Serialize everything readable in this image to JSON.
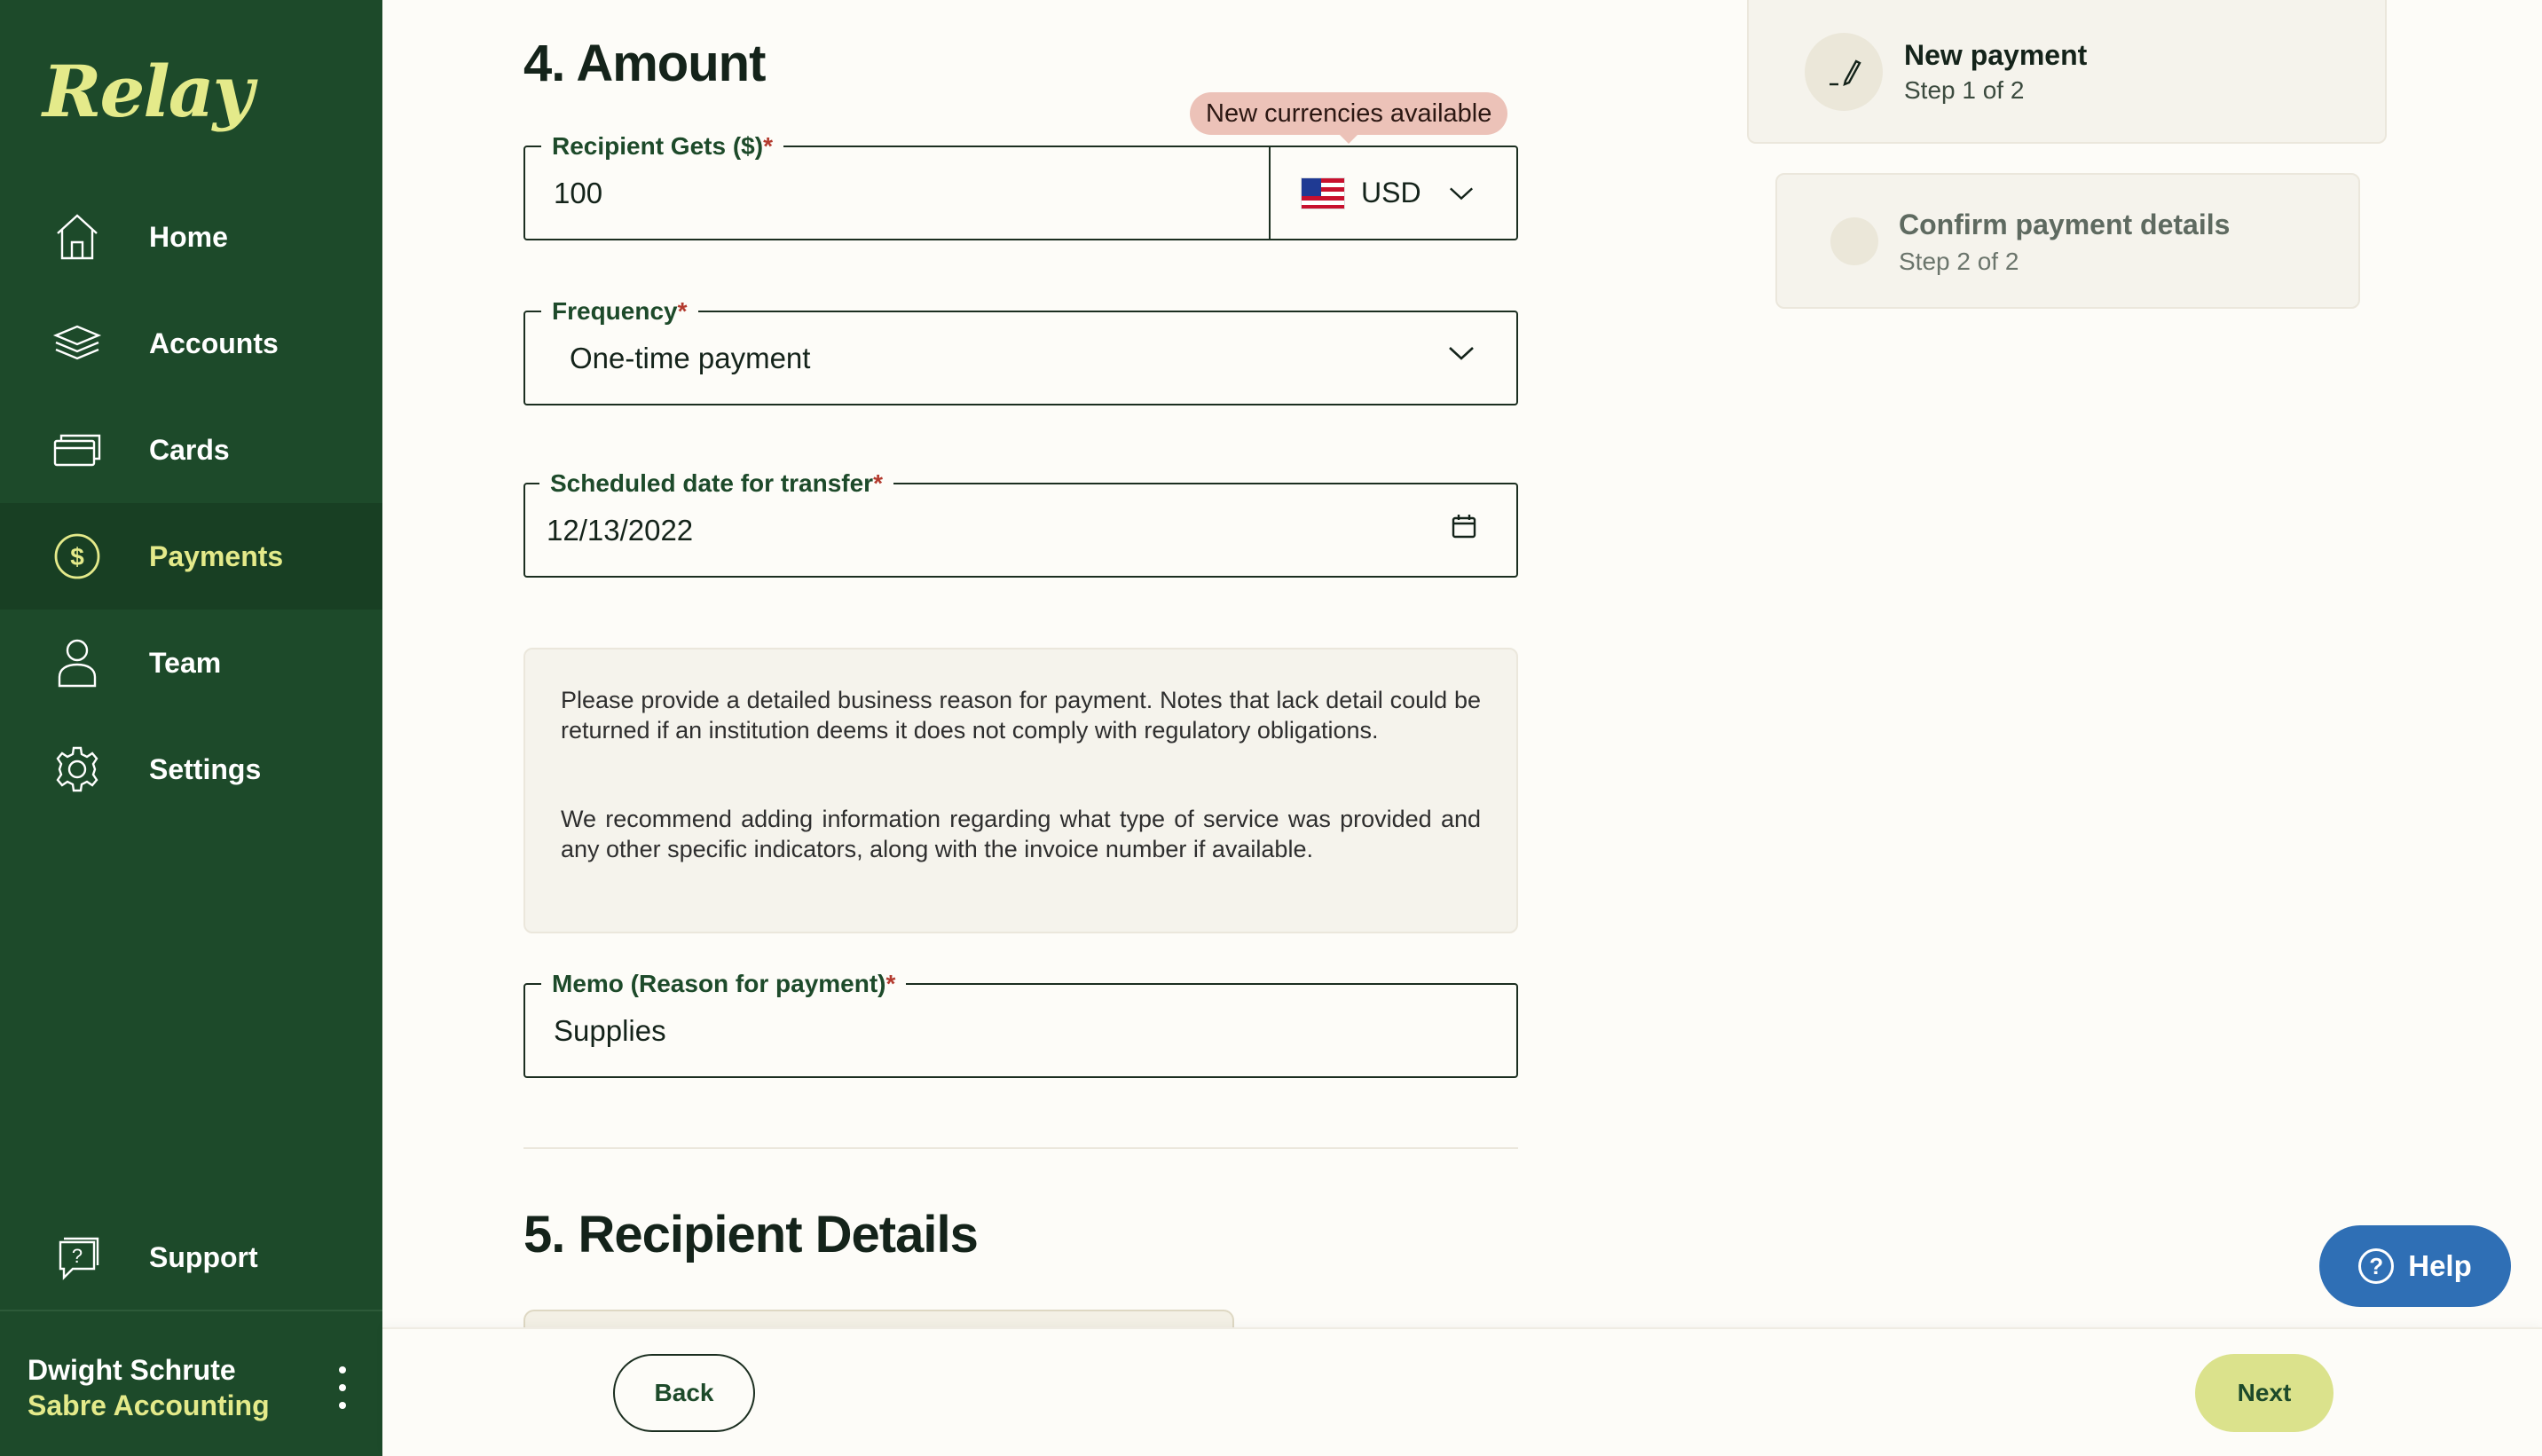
{
  "app": {
    "logo": "Relay"
  },
  "sidebar": {
    "items": [
      {
        "label": "Home",
        "icon": "home-icon"
      },
      {
        "label": "Accounts",
        "icon": "layers-icon"
      },
      {
        "label": "Cards",
        "icon": "cards-icon"
      },
      {
        "label": "Payments",
        "icon": "dollar-circle-icon",
        "active": true
      },
      {
        "label": "Team",
        "icon": "person-icon"
      },
      {
        "label": "Settings",
        "icon": "gear-icon"
      }
    ],
    "support": {
      "label": "Support",
      "icon": "help-chat-icon"
    },
    "user": {
      "name": "Dwight Schrute",
      "company": "Sabre Accounting"
    }
  },
  "amount_section": {
    "title": "4. Amount",
    "badge": "New currencies available",
    "recipient_gets": {
      "label": "Recipient Gets ($)",
      "required_mark": "*",
      "value": "100"
    },
    "currency": {
      "code": "USD",
      "flag": "us-flag"
    },
    "frequency": {
      "label": "Frequency",
      "required_mark": "*",
      "value": "One-time payment"
    },
    "scheduled_date": {
      "label": "Scheduled date for transfer",
      "required_mark": "*",
      "value": "12/13/2022"
    },
    "note": {
      "paragraph1": "Please provide a detailed business reason for payment. Notes that lack detail could be returned if an institution deems it does not comply with regulatory obligations.",
      "paragraph2": "We recommend adding information regarding what type of service was provided and any other specific indicators, along with the invoice number if available."
    },
    "memo": {
      "label": "Memo (Reason for payment)",
      "required_mark": "*",
      "value": "Supplies"
    }
  },
  "recipient_section": {
    "title": "5. Recipient Details"
  },
  "footer": {
    "back_label": "Back",
    "next_label": "Next"
  },
  "steps": [
    {
      "title": "New payment",
      "subtitle": "Step 1 of 2"
    },
    {
      "title": "Confirm payment details",
      "subtitle": "Step 2 of 2"
    }
  ],
  "help": {
    "label": "Help"
  },
  "colors": {
    "sidebar_bg": "#1d4a2a",
    "accent": "#e4ea8a",
    "next_btn": "#dbe28c",
    "help_btn": "#2f6fb5",
    "badge": "#ecc2b8"
  }
}
